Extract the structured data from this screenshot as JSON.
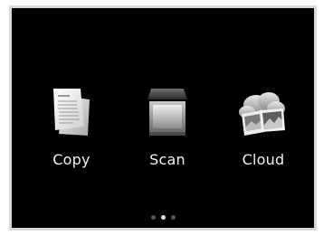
{
  "apps": [
    {
      "label": "Copy",
      "icon": "copy-document-icon"
    },
    {
      "label": "Scan",
      "icon": "flatbed-scanner-icon"
    },
    {
      "label": "Cloud",
      "icon": "cloud-photos-icon"
    }
  ],
  "pagination": {
    "total_pages": 3,
    "current_page": 2
  },
  "colors": {
    "screen_background": "#000000",
    "label_text": "#f2f2f2",
    "frame_border": "#d9d9d9",
    "dot_inactive": "#555555",
    "dot_active": "#e6e6e6"
  }
}
